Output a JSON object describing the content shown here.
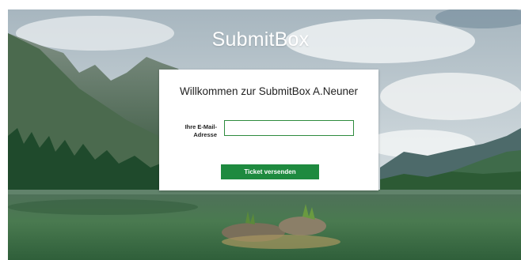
{
  "page": {
    "brand": "SubmitBox"
  },
  "login_card": {
    "title": "Willkommen zur SubmitBox A.Neuner",
    "email_label": "Ihre E-Mail-Adresse",
    "email_value": "",
    "submit_label": "Ticket versenden"
  },
  "colors": {
    "accent": "#1e8a3f",
    "input_border": "#2e8b3e"
  }
}
